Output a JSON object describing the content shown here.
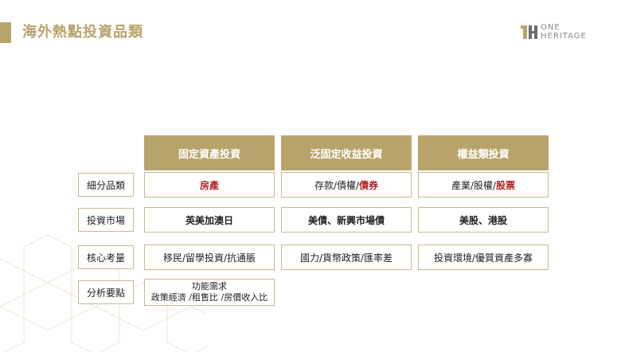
{
  "title": "海外熱點投資品類",
  "logo": {
    "line1": "ONE",
    "line2": "HERITAGE"
  },
  "columns": [
    "固定資產投資",
    "泛固定收益投資",
    "權益類投資"
  ],
  "rows": [
    {
      "label": "細分品類",
      "cells": [
        {
          "parts": [
            {
              "text": "房產",
              "style": "red"
            }
          ]
        },
        {
          "parts": [
            {
              "text": "存款/債權/",
              "style": "normal"
            },
            {
              "text": "債券",
              "style": "red"
            }
          ]
        },
        {
          "parts": [
            {
              "text": "產業/股權/",
              "style": "normal"
            },
            {
              "text": "股票",
              "style": "red"
            }
          ]
        }
      ]
    },
    {
      "label": "投資市場",
      "cells": [
        {
          "parts": [
            {
              "text": "英美加澳日",
              "style": "bold"
            }
          ]
        },
        {
          "parts": [
            {
              "text": "美債、新興市場債",
              "style": "bold"
            }
          ]
        },
        {
          "parts": [
            {
              "text": "美股、港股",
              "style": "bold"
            }
          ]
        }
      ]
    },
    {
      "label": "核心考量",
      "cells": [
        {
          "parts": [
            {
              "text": "移民/留學投資/抗通脹",
              "style": "normal"
            }
          ]
        },
        {
          "parts": [
            {
              "text": "國力/貨幣政策/匯率差",
              "style": "normal"
            }
          ]
        },
        {
          "parts": [
            {
              "text": "投資環境/優質資產多寡",
              "style": "normal"
            }
          ]
        }
      ]
    },
    {
      "label": "分析要點",
      "cells": [
        {
          "lines": [
            "功能需求",
            "政策經濟 /租售比 /房價收入比"
          ]
        }
      ]
    }
  ],
  "colors": {
    "accent": "#b8a36b",
    "border": "#c9b98e",
    "highlight": "#b22222"
  }
}
